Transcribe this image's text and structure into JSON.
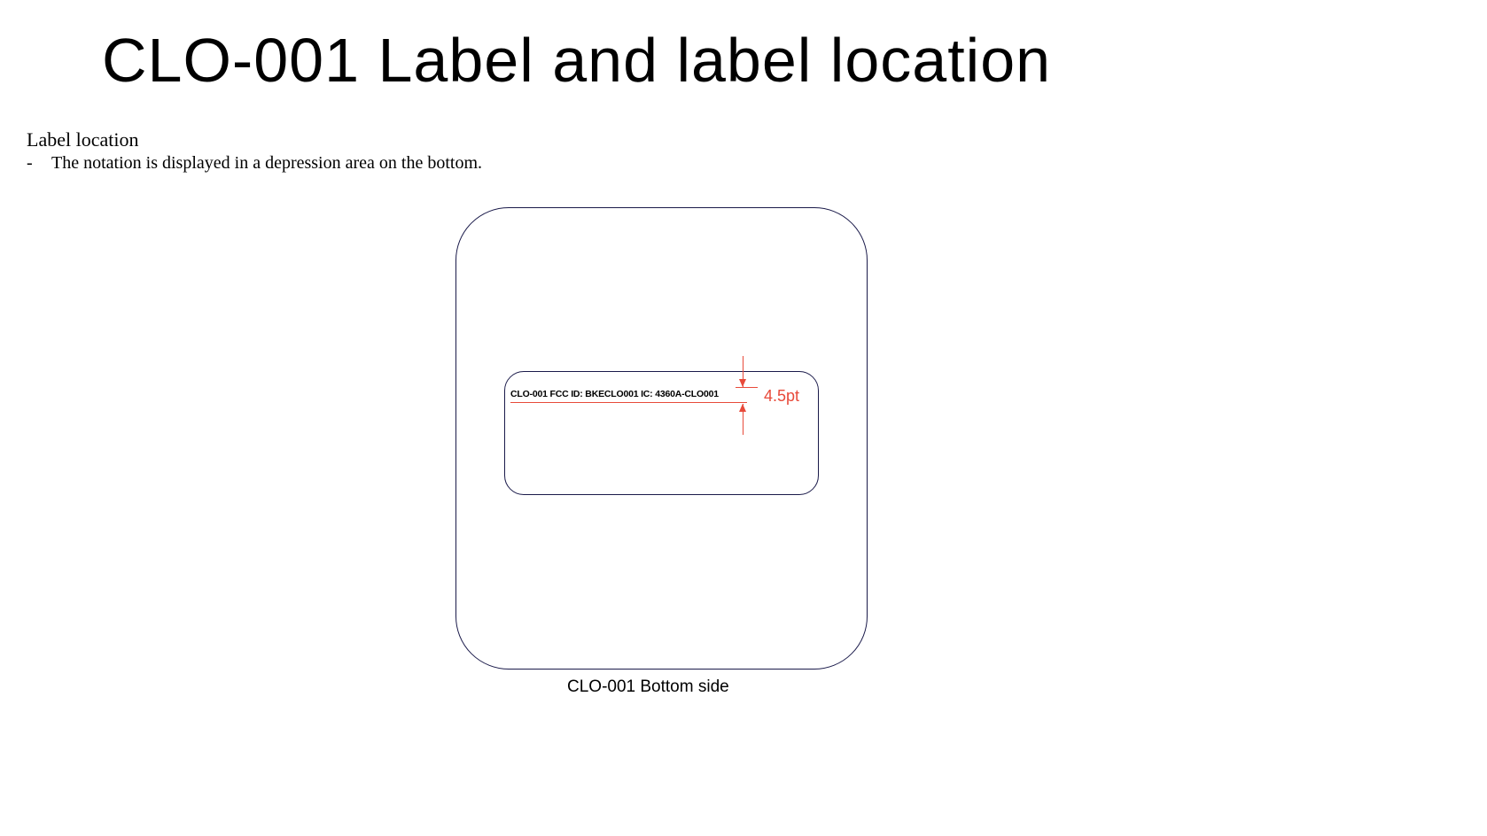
{
  "title": "CLO-001 Label and label location",
  "section_heading": "Label location",
  "bullet_text": "The notation is displayed in a depression area on the bottom.",
  "label_content": "CLO-001  FCC ID: BKECLO001  IC: 4360A-CLO001",
  "dimension": "4.5pt",
  "caption": "CLO-001  Bottom side"
}
